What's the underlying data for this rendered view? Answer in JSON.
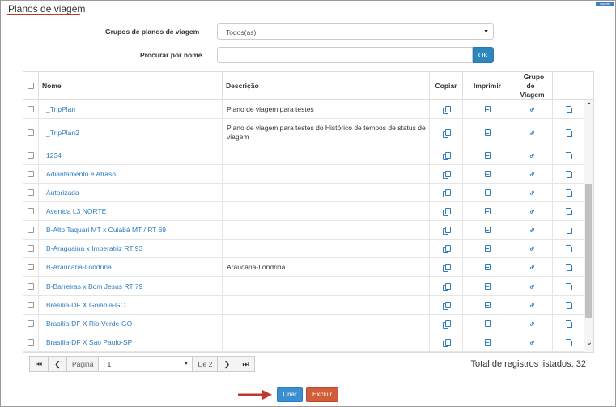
{
  "page": {
    "title": "Planos de viagem",
    "corner_badge": "suporte"
  },
  "filters": {
    "group_label": "Grupos de planos de viagem",
    "group_value": "Todos(as)",
    "search_label": "Procurar por nome",
    "search_value": "",
    "ok_label": "OK"
  },
  "table": {
    "headers": {
      "name": "Nome",
      "description": "Descrição",
      "copy": "Copiar",
      "print": "Imprimir",
      "group_line1": "Grupo de",
      "group_line2": "Viagem"
    },
    "rows": [
      {
        "name": "_TripPlan",
        "description": "Plano de viagem para testes"
      },
      {
        "name": "_TripPlan2",
        "description": "Plano de viagem para testes do Histórico de tempos de status de viagem"
      },
      {
        "name": "1234",
        "description": ""
      },
      {
        "name": "Adiantamento e Atraso",
        "description": ""
      },
      {
        "name": "Autorizada",
        "description": ""
      },
      {
        "name": "Avenida L3 NORTE",
        "description": ""
      },
      {
        "name": "B-Alto Taquari MT x Cuiabá MT / RT 69",
        "description": ""
      },
      {
        "name": "B-Araguaina x Imperatriz RT 93",
        "description": ""
      },
      {
        "name": "B-Araucaria-Londrina",
        "description": "Araucaria-Londrina"
      },
      {
        "name": "B-Barreiras x Bom Jesus RT 79",
        "description": ""
      },
      {
        "name": "Brasília-DF X Goiania-GO",
        "description": ""
      },
      {
        "name": "Brasília-DF X Rio Verde-GO",
        "description": ""
      },
      {
        "name": "Brasília-DF X Sao Paulo-SP",
        "description": ""
      }
    ]
  },
  "pagination": {
    "page_label": "Página",
    "page_value": "1",
    "of_label": "De 2",
    "total_text": "Total de registros listados: 32"
  },
  "actions": {
    "create_label": "Criar",
    "delete_label": "Excluir"
  },
  "colors": {
    "accent": "#2e86c1",
    "danger": "#d35c3a",
    "title_underline": "#c0392b",
    "link": "#2f7bbf"
  }
}
